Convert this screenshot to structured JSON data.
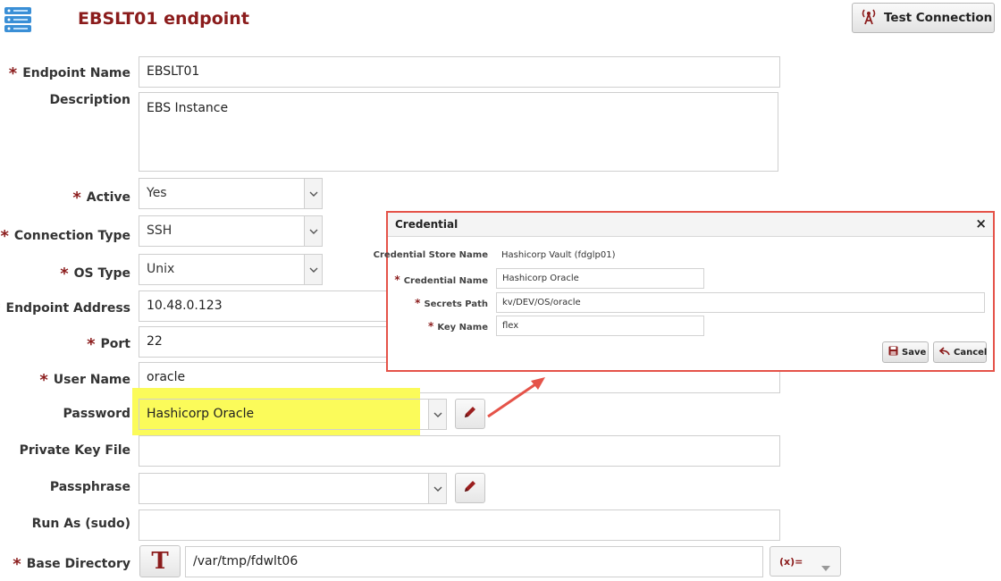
{
  "header": {
    "title": "EBSLT01 endpoint",
    "test_connection_label": "Test Connection"
  },
  "form": {
    "endpoint_name": {
      "label": "Endpoint Name",
      "value": "EBSLT01"
    },
    "description": {
      "label": "Description",
      "value": "EBS Instance"
    },
    "active": {
      "label": "Active",
      "value": "Yes"
    },
    "connection_type": {
      "label": "Connection Type",
      "value": "SSH"
    },
    "os_type": {
      "label": "OS Type",
      "value": "Unix"
    },
    "endpoint_address": {
      "label": "Endpoint Address",
      "value": "10.48.0.123"
    },
    "port": {
      "label": "Port",
      "value": "22"
    },
    "user_name": {
      "label": "User Name",
      "value": "oracle"
    },
    "password": {
      "label": "Password",
      "value": "Hashicorp Oracle"
    },
    "private_key_file": {
      "label": "Private Key File",
      "value": ""
    },
    "passphrase": {
      "label": "Passphrase",
      "value": ""
    },
    "run_as": {
      "label": "Run As (sudo)",
      "value": ""
    },
    "base_directory": {
      "label": "Base Directory",
      "value": "/var/tmp/fdwlt06",
      "type_glyph": "T",
      "expression_label": "(x)="
    }
  },
  "credential_dialog": {
    "title": "Credential",
    "close_glyph": "×",
    "store_name_label": "Credential Store Name",
    "store_name_value": "Hashicorp Vault (fdglp01)",
    "credential_name_label": "Credential Name",
    "credential_name_value": "Hashicorp Oracle",
    "secrets_path_label": "Secrets Path",
    "secrets_path_value": "kv/DEV/OS/oracle",
    "key_name_label": "Key Name",
    "key_name_value": "flex",
    "save_label": "Save",
    "cancel_label": "Cancel"
  },
  "required_marker": "*",
  "colors": {
    "title": "#8b1c1c",
    "required": "#8b1c1c",
    "highlight": "#fbfb5a",
    "dialog_border": "#e55349",
    "arrow": "#e55349"
  },
  "icons": {
    "app": "server-stack-icon",
    "test": "antenna-icon",
    "edit": "pencil-icon",
    "save": "floppy-icon",
    "cancel": "undo-icon",
    "dropdown": "chevron-down-icon"
  }
}
